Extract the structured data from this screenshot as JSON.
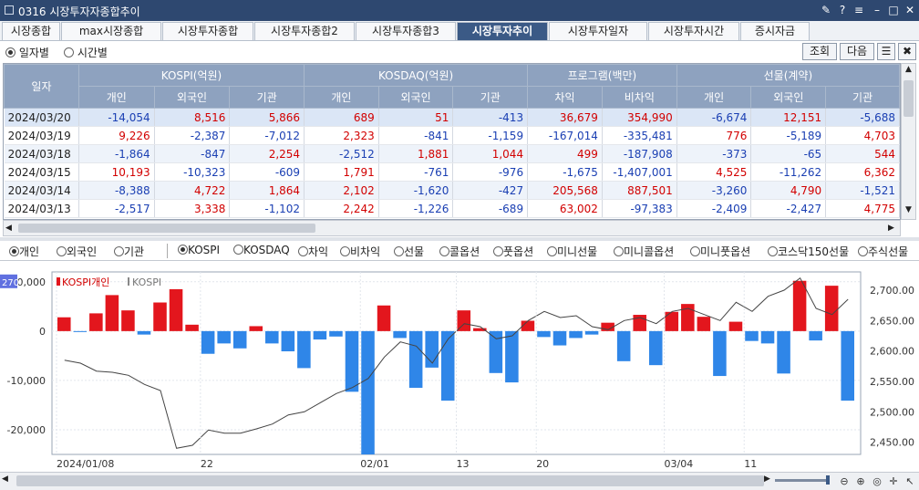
{
  "window": {
    "title": "0316 시장투자자종합추이"
  },
  "tabs": [
    "시장종합",
    "max시장종합",
    "시장투자종합",
    "시장투자종합2",
    "시장투자종합3",
    "시장투자추이",
    "시장투자일자",
    "시장투자시간",
    "증시자금"
  ],
  "active_tab": 5,
  "toolbar": {
    "radio_daily": "일자별",
    "radio_time": "시간별",
    "btn_search": "조회",
    "btn_next": "다음"
  },
  "grid": {
    "col_date": "일자",
    "groups": [
      "KOSPI(억원)",
      "KOSDAQ(억원)",
      "프로그램(백만)",
      "선물(계약)"
    ],
    "subheaders": [
      "개인",
      "외국인",
      "기관",
      "개인",
      "외국인",
      "기관",
      "차익",
      "비차익",
      "개인",
      "외국인",
      "기관"
    ],
    "rows": [
      [
        "2024/03/20",
        "-14,054",
        "8,516",
        "5,866",
        "689",
        "51",
        "-413",
        "36,679",
        "354,990",
        "-6,674",
        "12,151",
        "-5,688"
      ],
      [
        "2024/03/19",
        "9,226",
        "-2,387",
        "-7,012",
        "2,323",
        "-841",
        "-1,159",
        "-167,014",
        "-335,481",
        "776",
        "-5,189",
        "4,703"
      ],
      [
        "2024/03/18",
        "-1,864",
        "-847",
        "2,254",
        "-2,512",
        "1,881",
        "1,044",
        "499",
        "-187,908",
        "-373",
        "-65",
        "544"
      ],
      [
        "2024/03/15",
        "10,193",
        "-10,323",
        "-609",
        "1,791",
        "-761",
        "-976",
        "-1,675",
        "-1,407,001",
        "4,525",
        "-11,262",
        "6,362"
      ],
      [
        "2024/03/14",
        "-8,388",
        "4,722",
        "1,864",
        "2,102",
        "-1,620",
        "-427",
        "205,568",
        "887,501",
        "-3,260",
        "4,790",
        "-1,521"
      ],
      [
        "2024/03/13",
        "-2,517",
        "3,338",
        "-1,102",
        "2,242",
        "-1,226",
        "-689",
        "63,002",
        "-97,383",
        "-2,409",
        "-2,427",
        "4,775"
      ]
    ]
  },
  "investor_options": [
    "개인",
    "외국인",
    "기관"
  ],
  "investor_selected": 0,
  "market_options": [
    "KOSPI",
    "KOSDAQ",
    "차익",
    "비차익",
    "선물",
    "콜옵션",
    "풋옵션",
    "미니선물",
    "미니콜옵션",
    "미니풋옵션",
    "코스닥150선물",
    "주식선물"
  ],
  "market_selected": 0,
  "chart_data": {
    "type": "bar",
    "legend": [
      "KOSPI개인",
      "KOSPI"
    ],
    "left_ticks": [
      "10,000",
      "0",
      "-10,000",
      "-20,000"
    ],
    "right_ticks": [
      "2,700.00",
      "2,650.00",
      "2,600.00",
      "2,550.00",
      "2,500.00",
      "2,450.00"
    ],
    "x_ticks": [
      "2024/01/08",
      "22",
      "02/01",
      "13",
      "20",
      "03/04",
      "11"
    ],
    "cursor_label": "270",
    "ylim_left": [
      -25000,
      12000
    ],
    "ylim_right": [
      2430,
      2730
    ],
    "series": [
      {
        "name": "KOSPI개인",
        "values": [
          2800,
          -100,
          3600,
          7300,
          4200,
          -700,
          5800,
          8500,
          1300,
          -4600,
          -2500,
          -3500,
          1000,
          -2500,
          -4100,
          -7500,
          -1700,
          -1100,
          -12300,
          -25000,
          5200,
          -1400,
          -11500,
          -7400,
          -14100,
          4200,
          600,
          -8500,
          -10400,
          2100,
          -1200,
          -2900,
          -1400,
          -700,
          1700,
          -6100,
          3300,
          -6900,
          3900,
          5500,
          2900,
          -9100,
          1900,
          -2000,
          -2500,
          -8600,
          10200,
          -1900,
          9200,
          -14100
        ]
      },
      {
        "name": "KOSPI",
        "values": [
          2585,
          2580,
          2567,
          2565,
          2560,
          2545,
          2535,
          2440,
          2445,
          2470,
          2465,
          2465,
          2472,
          2480,
          2495,
          2500,
          2515,
          2530,
          2540,
          2555,
          2590,
          2615,
          2608,
          2580,
          2620,
          2645,
          2640,
          2620,
          2625,
          2650,
          2665,
          2655,
          2658,
          2640,
          2635,
          2650,
          2655,
          2645,
          2665,
          2670,
          2660,
          2650,
          2680,
          2665,
          2690,
          2700,
          2720,
          2670,
          2660,
          2685
        ]
      }
    ]
  }
}
